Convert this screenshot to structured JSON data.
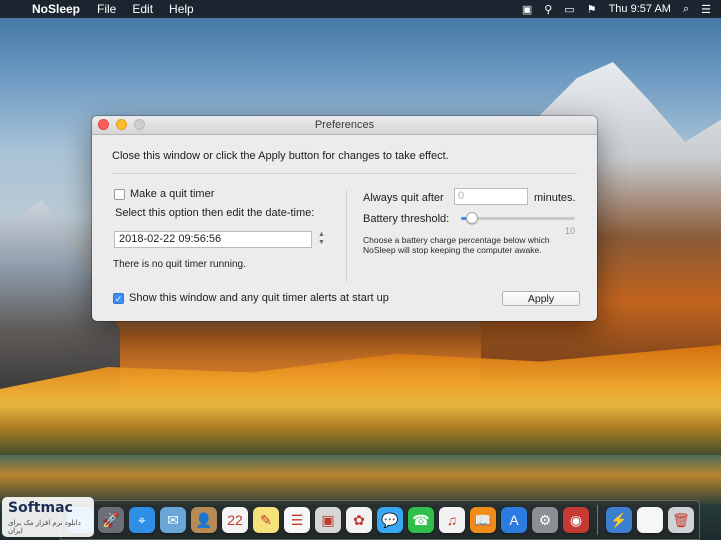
{
  "menubar": {
    "app_name": "NoSleep",
    "menus": [
      "File",
      "Edit",
      "Help"
    ],
    "status_icons": [
      "display-icon",
      "satellite-icon",
      "airplay-icon",
      "flag-us-icon"
    ],
    "clock": "Thu 9:57 AM"
  },
  "window": {
    "title": "Preferences",
    "instructions": "Close this window or click the Apply button for changes to take effect.",
    "quit_timer": {
      "label": "Make a quit timer",
      "checked": false,
      "help": "Select this option then edit the date-time:",
      "datetime": "2018-02-22 09:56:56",
      "status": "There is no quit timer running."
    },
    "always_quit": {
      "label": "Always quit after",
      "placeholder": "0",
      "unit": "minutes."
    },
    "battery": {
      "label": "Battery threshold:",
      "slider_value": 10,
      "slider_min": 0,
      "slider_max": 100,
      "value_text": "10",
      "help": "Choose a battery charge percentage below which NoSleep will stop keeping the computer awake."
    },
    "show_alerts": {
      "label": "Show this window and any quit timer alerts at start up",
      "checked": true
    },
    "apply_label": "Apply"
  },
  "dock": {
    "icons": [
      {
        "name": "finder-icon",
        "color": "#4aa3f0",
        "glyph": "☺"
      },
      {
        "name": "launchpad-icon",
        "color": "#6b6f78",
        "glyph": "🚀"
      },
      {
        "name": "safari-icon",
        "color": "#2f8ee6",
        "glyph": "⌖"
      },
      {
        "name": "mail-icon",
        "color": "#6aa6d8",
        "glyph": "✉"
      },
      {
        "name": "contacts-icon",
        "color": "#b58a55",
        "glyph": "👤"
      },
      {
        "name": "calendar-icon",
        "color": "#f4f4f4",
        "glyph": "22"
      },
      {
        "name": "notes-icon",
        "color": "#f5e27a",
        "glyph": "✎"
      },
      {
        "name": "reminders-icon",
        "color": "#f7f7f7",
        "glyph": "☰"
      },
      {
        "name": "preview-icon",
        "color": "#d6d6d6",
        "glyph": "▣"
      },
      {
        "name": "photos-icon",
        "color": "#f3f3f3",
        "glyph": "✿"
      },
      {
        "name": "messages-icon",
        "color": "#39a7f2",
        "glyph": "💬"
      },
      {
        "name": "facetime-icon",
        "color": "#2fbf4a",
        "glyph": "☎"
      },
      {
        "name": "itunes-icon",
        "color": "#f2f2f2",
        "glyph": "♫"
      },
      {
        "name": "ibooks-icon",
        "color": "#f08d1a",
        "glyph": "📖"
      },
      {
        "name": "app-store-icon",
        "color": "#2b7be0",
        "glyph": "A"
      },
      {
        "name": "system-preferences-icon",
        "color": "#8a8f96",
        "glyph": "⚙"
      },
      {
        "name": "photo-booth-icon",
        "color": "#c53a33",
        "glyph": "◉"
      }
    ],
    "trailing_icons": [
      {
        "name": "nosleep-icon",
        "color": "#3c7fd1",
        "glyph": "⚡"
      },
      {
        "name": "document-icon",
        "color": "#f6f6f6",
        "glyph": ""
      },
      {
        "name": "trash-icon",
        "color": "#cfd3d8",
        "glyph": "🗑"
      }
    ]
  },
  "watermark": {
    "main": "Softmac",
    "sub": "دانلود نرم افزار مک برای ایران"
  }
}
